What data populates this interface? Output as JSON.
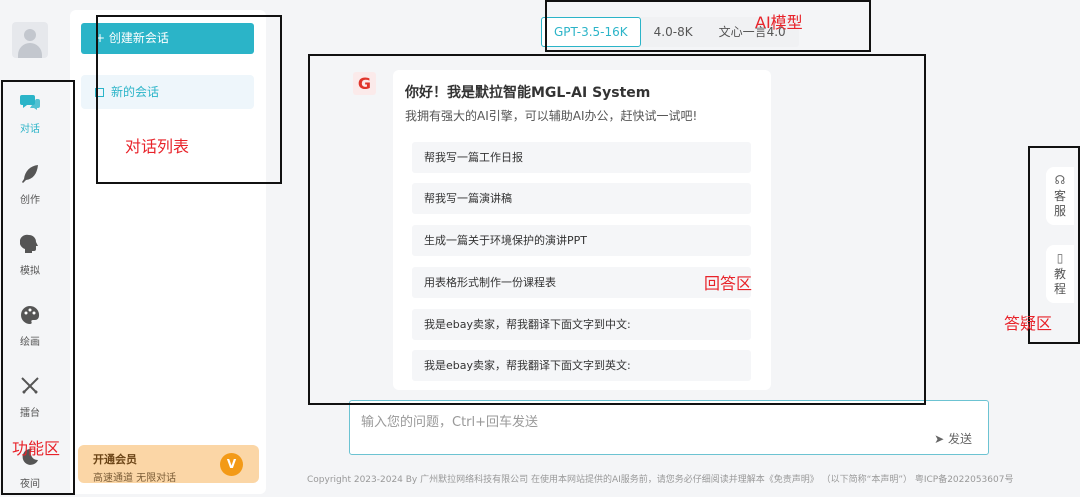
{
  "nav": {
    "items": [
      {
        "label": "对话",
        "icon": "chat-icon"
      },
      {
        "label": "创作",
        "icon": "feather-icon"
      },
      {
        "label": "模拟",
        "icon": "head-icon"
      },
      {
        "label": "绘画",
        "icon": "palette-icon"
      },
      {
        "label": "擂台",
        "icon": "swords-icon"
      },
      {
        "label": "夜间",
        "icon": "moon-icon"
      }
    ]
  },
  "conversations": {
    "new_button": "+ 创建新会话",
    "items": [
      {
        "label": "新的会话"
      }
    ]
  },
  "member": {
    "title": "开通会员",
    "subtitle": "高速通道 无限对话",
    "badge": "V"
  },
  "models": {
    "tabs": [
      "GPT-3.5-16K",
      "4.0-8K",
      "文心一言4.0"
    ],
    "selected": "GPT-3.5-16K"
  },
  "bot": {
    "logo": "G",
    "greeting": "你好！我是默拉智能MGL-AI System",
    "intro": "我拥有强大的AI引擎，可以辅助AI办公，赶快试一试吧!",
    "suggestions": [
      "帮我写一篇工作日报",
      "帮我写一篇演讲稿",
      "生成一篇关于环境保护的演讲PPT",
      "用表格形式制作一份课程表",
      "我是ebay卖家，帮我翻译下面文字到中文:",
      "我是ebay卖家，帮我翻译下面文字到英文:"
    ]
  },
  "input": {
    "placeholder": "输入您的问题，Ctrl+回车发送",
    "send_label": "发送"
  },
  "side": {
    "service": "客服",
    "tutorial": "教程"
  },
  "footer": "Copyright 2023-2024 By 广州默拉网络科技有限公司 在使用本网站提供的AI服务前，请您务必仔细阅读并理解本《免责声明》 （以下简称“本声明”）   粤ICP备2022053607号",
  "annotations": {
    "model": "AI模型",
    "conv_list": "对话列表",
    "answer": "回答区",
    "qa": "答疑区",
    "function": "功能区"
  },
  "colors": {
    "accent": "#2bb4c8",
    "annotation": "#e8232a",
    "member_bg": "#fbd6a6"
  }
}
